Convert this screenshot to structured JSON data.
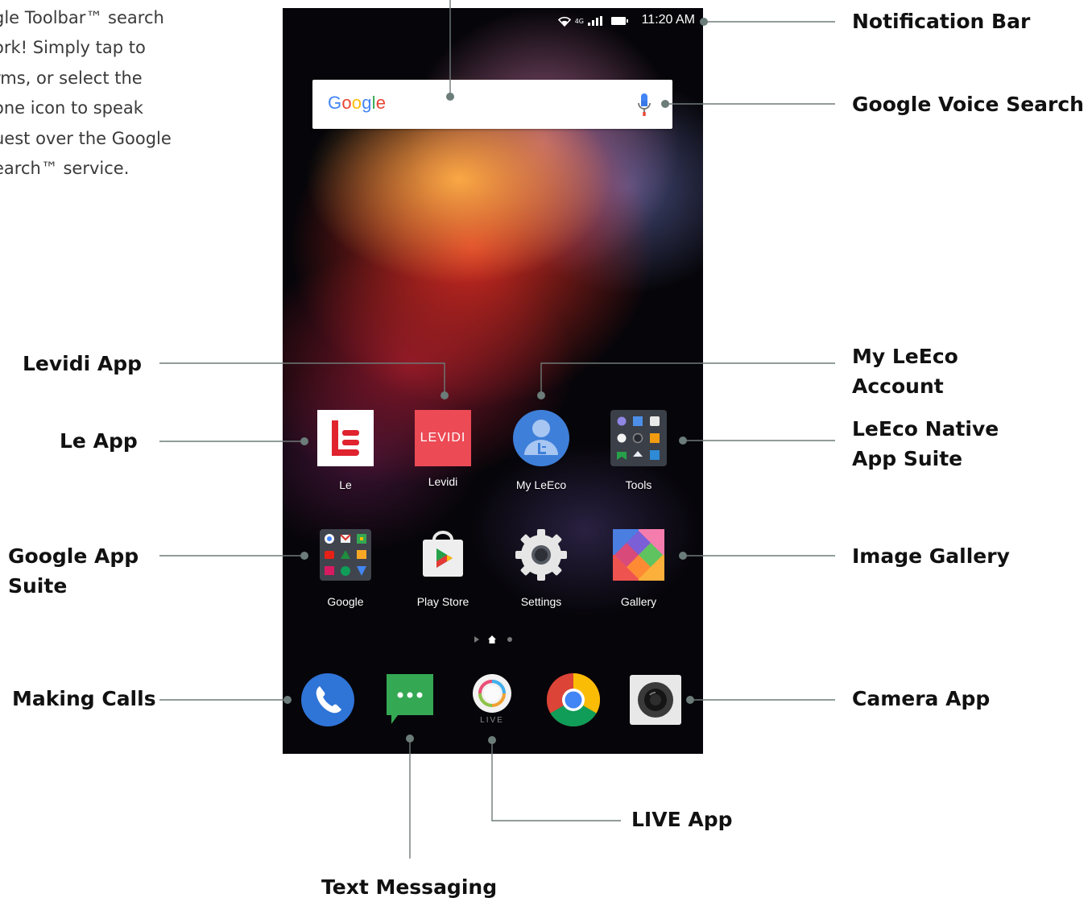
{
  "intro": {
    "lines": [
      "gle Toolbar™ search",
      "ork! Simply tap to",
      "rms, or select the",
      "one icon to speak",
      "uest over the Google",
      "earch™ service."
    ]
  },
  "status_bar": {
    "time": "11:20 AM",
    "network": "4G"
  },
  "search": {
    "logo": "Google",
    "mic_icon": "microphone-icon"
  },
  "apps": [
    {
      "label": "Le"
    },
    {
      "label": "Levidi",
      "icon_text": "LEVIDI"
    },
    {
      "label": "My LeEco"
    },
    {
      "label": "Tools"
    },
    {
      "label": "Google"
    },
    {
      "label": "Play Store"
    },
    {
      "label": "Settings"
    },
    {
      "label": "Gallery"
    }
  ],
  "dock": [
    {
      "name": "phone-icon"
    },
    {
      "name": "messaging-icon"
    },
    {
      "name": "live-icon",
      "sublabel": "LIVE"
    },
    {
      "name": "chrome-icon"
    },
    {
      "name": "camera-icon"
    }
  ],
  "callouts": {
    "notification_bar": "Notification Bar",
    "voice_search": "Google Voice Search",
    "levidi": "Levidi App",
    "le": "Le App",
    "my_leeco_1": "My LeEco",
    "my_leeco_2": "Account",
    "native_suite_1": "LeEco Native",
    "native_suite_2": "App Suite",
    "google_suite_1": "Google App",
    "google_suite_2": "Suite",
    "gallery": "Image Gallery",
    "calls": "Making Calls",
    "camera": "Camera App",
    "live": "LIVE App",
    "messaging": "Text Messaging"
  },
  "colors": {
    "callout_line": "#6e7a78",
    "callout_dot": "#6b7c79",
    "le_red": "#e0232f",
    "levidi_bg": "#ec4a55",
    "leeco_blue": "#3e7fd9"
  }
}
